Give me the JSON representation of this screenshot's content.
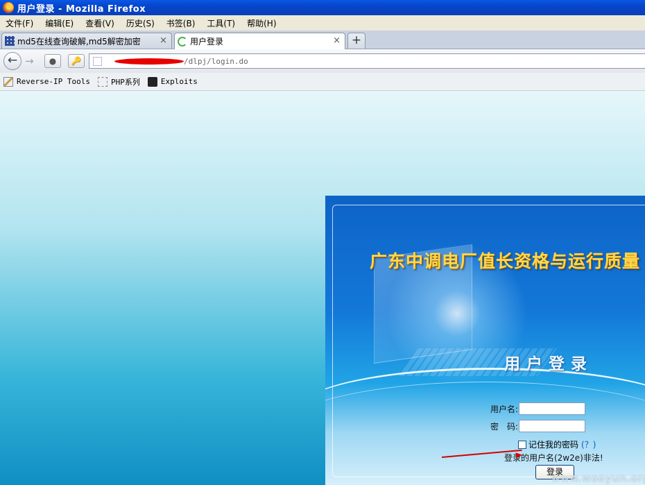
{
  "window": {
    "title": "用户登录 - Mozilla Firefox"
  },
  "menu": [
    "文件(F)",
    "编辑(E)",
    "查看(V)",
    "历史(S)",
    "书签(B)",
    "工具(T)",
    "帮助(H)"
  ],
  "tabs": [
    {
      "label": "md5在线查询破解,md5解密加密",
      "close": "×"
    },
    {
      "label": "用户登录",
      "close": "×"
    }
  ],
  "new_tab_label": "+",
  "address": {
    "url_visible": "/dlpj/login.do"
  },
  "bookmarks": [
    "Reverse-IP Tools",
    "PHP系列",
    "Exploits"
  ],
  "page": {
    "system_title": "广东中调电厂值长资格与运行质量",
    "login_heading": "用户登录",
    "username_label": "用户名:",
    "password_label": "密　码:",
    "remember_label": "记住我的密码",
    "help_link": "(？)",
    "error_message": "登录的用户名(2w2e)非法!",
    "submit_label": "登录"
  },
  "watermark": "www.wooyun.org"
}
